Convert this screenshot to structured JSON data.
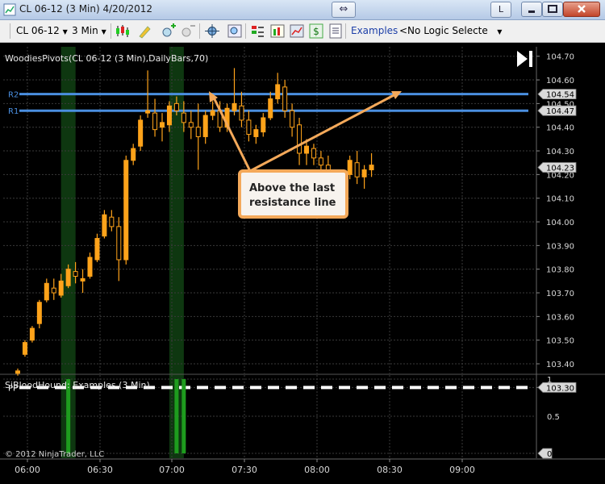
{
  "window": {
    "title": "CL 06-12 (3 Min)  4/20/2012",
    "sync_icon": "double-arrow-icon",
    "l_label": "L"
  },
  "toolbar": {
    "instrument": "CL 06-12",
    "interval": "3 Min",
    "examples_link": "Examples",
    "logic_select": "<No Logic Selecte",
    "icons": [
      "chart-style-icon",
      "drawing-tool-icon",
      "zoom-in-icon",
      "zoom-out-icon",
      "crosshair-icon",
      "magnifier-icon",
      "indicators-icon",
      "strategies-icon",
      "chart-trader-icon",
      "dollar-icon",
      "properties-icon"
    ]
  },
  "colors": {
    "background": "#000000",
    "up_candle": "#000000",
    "candle": "#ffa31a",
    "pivot_line": "#4a8fe0",
    "pp_line": "#ffffff",
    "highlight": "#0f3d12",
    "signal_bar": "#1e9c1e",
    "callout": "#f4a95a"
  },
  "panel_labels": {
    "upper": "WoodiesPivots(CL 06-12 (3 Min),DailyBars,70)",
    "lower": "SiBloodHound: Examples (3 Min)",
    "copyright": "© 2012 NinjaTrader, LLC"
  },
  "callout": {
    "text_line1": "Above the last",
    "text_line2": "resistance line"
  },
  "chart_data": {
    "type": "candlestick",
    "x_ticks": [
      "06:00",
      "06:30",
      "07:00",
      "07:30",
      "08:00",
      "08:30",
      "09:00"
    ],
    "y_ticks": [
      "104.70",
      "104.60",
      "104.50",
      "104.40",
      "104.30",
      "104.20",
      "104.10",
      "104.00",
      "103.90",
      "103.80",
      "103.70",
      "103.60",
      "103.50",
      "103.40",
      "103.30"
    ],
    "ylim": [
      103.25,
      104.74
    ],
    "lines": [
      {
        "name": "R2",
        "value": 104.54,
        "label": "104.54"
      },
      {
        "name": "R1",
        "value": 104.47,
        "label": "104.47"
      },
      {
        "name": "PP",
        "value": 103.3,
        "label": "103.30"
      }
    ],
    "last_price": {
      "value": 104.23,
      "label": "104.23"
    },
    "lower_panel": {
      "y_ticks": [
        "1",
        "0.5",
        "0"
      ],
      "ylim": [
        0,
        1
      ],
      "signal_bars": [
        7,
        22,
        23
      ]
    },
    "highlight_bars": [
      7,
      22
    ],
    "candles": [
      [
        103.36,
        103.38,
        103.35,
        103.37
      ],
      [
        103.44,
        103.5,
        103.43,
        103.49
      ],
      [
        103.5,
        103.56,
        103.49,
        103.55
      ],
      [
        103.57,
        103.67,
        103.55,
        103.66
      ],
      [
        103.67,
        103.76,
        103.66,
        103.74
      ],
      [
        103.72,
        103.76,
        103.67,
        103.7
      ],
      [
        103.69,
        103.78,
        103.68,
        103.75
      ],
      [
        103.73,
        103.82,
        103.72,
        103.8
      ],
      [
        103.79,
        103.83,
        103.74,
        103.77
      ],
      [
        103.75,
        103.8,
        103.7,
        103.76
      ],
      [
        103.77,
        103.87,
        103.76,
        103.85
      ],
      [
        103.84,
        103.95,
        103.83,
        103.93
      ],
      [
        103.94,
        104.05,
        103.93,
        104.03
      ],
      [
        104.02,
        104.05,
        103.96,
        103.98
      ],
      [
        103.98,
        104.02,
        103.75,
        103.84
      ],
      [
        103.84,
        104.28,
        103.82,
        104.26
      ],
      [
        104.26,
        104.33,
        104.24,
        104.31
      ],
      [
        104.32,
        104.45,
        104.3,
        104.43
      ],
      [
        104.46,
        104.64,
        104.44,
        104.47
      ],
      [
        104.46,
        104.52,
        104.36,
        104.39
      ],
      [
        104.4,
        104.46,
        104.34,
        104.42
      ],
      [
        104.41,
        104.51,
        104.38,
        104.49
      ],
      [
        104.5,
        104.53,
        104.45,
        104.47
      ],
      [
        104.46,
        104.51,
        104.38,
        104.42
      ],
      [
        104.42,
        104.47,
        104.35,
        104.4
      ],
      [
        104.4,
        104.5,
        104.22,
        104.36
      ],
      [
        104.36,
        104.47,
        104.33,
        104.45
      ],
      [
        104.45,
        104.51,
        104.43,
        104.47
      ],
      [
        104.47,
        104.51,
        104.38,
        104.4
      ],
      [
        104.4,
        104.5,
        104.38,
        104.48
      ],
      [
        104.47,
        104.65,
        104.45,
        104.5
      ],
      [
        104.49,
        104.55,
        104.4,
        104.43
      ],
      [
        104.43,
        104.47,
        104.34,
        104.37
      ],
      [
        104.36,
        104.41,
        104.33,
        104.39
      ],
      [
        104.38,
        104.46,
        104.36,
        104.44
      ],
      [
        104.44,
        104.55,
        104.43,
        104.52
      ],
      [
        104.52,
        104.63,
        104.5,
        104.58
      ],
      [
        104.57,
        104.6,
        104.44,
        104.47
      ],
      [
        104.47,
        104.5,
        104.36,
        104.4
      ],
      [
        104.41,
        104.44,
        104.24,
        104.29
      ],
      [
        104.29,
        104.35,
        104.24,
        104.32
      ],
      [
        104.31,
        104.33,
        104.24,
        104.27
      ],
      [
        104.27,
        104.3,
        104.2,
        104.24
      ],
      [
        104.24,
        104.28,
        104.06,
        104.1
      ],
      [
        104.1,
        104.2,
        104.06,
        104.17
      ],
      [
        104.17,
        104.22,
        104.14,
        104.2
      ],
      [
        104.2,
        104.28,
        104.18,
        104.26
      ],
      [
        104.25,
        104.3,
        104.16,
        104.19
      ],
      [
        104.19,
        104.24,
        104.14,
        104.22
      ],
      [
        104.22,
        104.29,
        104.19,
        104.24
      ]
    ]
  }
}
